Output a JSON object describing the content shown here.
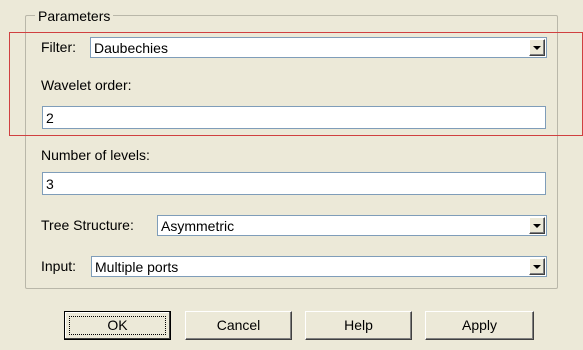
{
  "parameters": {
    "title": "Parameters",
    "filter": {
      "label": "Filter:",
      "value": "Daubechies"
    },
    "wavelet_order": {
      "label": "Wavelet order:",
      "value": "2"
    },
    "number_of_levels": {
      "label": "Number of levels:",
      "value": "3"
    },
    "tree_structure": {
      "label": "Tree Structure:",
      "value": "Asymmetric"
    },
    "input": {
      "label": "Input:",
      "value": "Multiple ports"
    }
  },
  "buttons": {
    "ok": "OK",
    "cancel": "Cancel",
    "help": "Help",
    "apply": "Apply"
  },
  "colors": {
    "highlight": "#d04040",
    "dialog_bg": "#ece9d8"
  }
}
